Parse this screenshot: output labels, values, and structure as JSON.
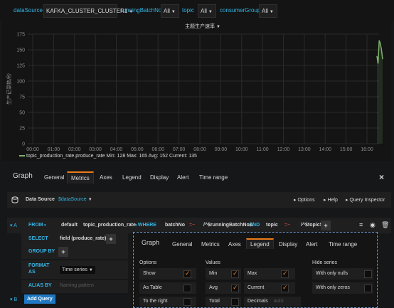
{
  "vars": [
    {
      "label": "dataSource",
      "value": "KAFKA_CLUSTER_CLUSTER1"
    },
    {
      "label": "runningBatchNo",
      "value": "All"
    },
    {
      "label": "topic",
      "value": "All"
    },
    {
      "label": "consumerGroup",
      "value": "All"
    }
  ],
  "chart": {
    "title": "主题生产速率",
    "ylabel": "生产记录数/秒",
    "yticks": [
      "175",
      "150",
      "125",
      "100",
      "75",
      "50",
      "25",
      "0"
    ],
    "xticks": [
      "00:00",
      "01:00",
      "02:00",
      "03:00",
      "04:00",
      "05:00",
      "06:00",
      "07:00",
      "08:00",
      "09:00",
      "10:00",
      "11:00",
      "12:00",
      "13:00",
      "14:00",
      "15:00",
      "16:00"
    ],
    "legend": "topic_production_rate.produce_rate  Min: 128  Max: 165  Avg: 152  Current: 135"
  },
  "chart_data": {
    "type": "line",
    "title": "主题生产速率",
    "ylabel": "生产记录数/秒",
    "xlabel": "",
    "ylim": [
      0,
      175
    ],
    "x": [
      "16:40",
      "16:42",
      "16:44",
      "16:46",
      "16:48",
      "16:50"
    ],
    "series": [
      {
        "name": "topic_production_rate.produce_rate",
        "values": [
          140,
          128,
          165,
          160,
          150,
          135
        ]
      }
    ],
    "grid": true,
    "legend": "bottom-left"
  },
  "editor": {
    "header": "Graph",
    "tabs": [
      "General",
      "Metrics",
      "Axes",
      "Legend",
      "Display",
      "Alert",
      "Time range"
    ],
    "close": "×"
  },
  "datasource": {
    "label": "Data Source",
    "value": "$dataSource",
    "options": "Options",
    "help": "Help",
    "inspector": "Query Inspector"
  },
  "query": {
    "ref": "A",
    "from_kw": "FROM",
    "default": "default",
    "measurement": "topic_production_rate",
    "where_kw": "WHERE",
    "tag1": "batchNo",
    "op1": "=~",
    "val1": "/^$runningBatchNo$/",
    "and": "AND",
    "tag2": "topic",
    "op2": "=~",
    "val2": "/^$topic$/",
    "select_kw": "SELECT",
    "field": "field (produce_rate)",
    "groupby_kw": "GROUP BY",
    "format_kw": "FORMAT AS",
    "format_val": "Time series",
    "alias_kw": "ALIAS BY",
    "alias_placeholder": "Naming pattern",
    "ref_b": "B",
    "add_query": "Add Query"
  },
  "popup": {
    "header": "Graph",
    "tabs": [
      "General",
      "Metrics",
      "Axes",
      "Legend",
      "Display",
      "Alert",
      "Time range"
    ],
    "options_title": "Options",
    "values_title": "Values",
    "hide_title": "Hide series",
    "options": [
      {
        "label": "Show",
        "checked": true
      },
      {
        "label": "As Table",
        "checked": false
      },
      {
        "label": "To the right",
        "checked": false
      }
    ],
    "values_left": [
      {
        "label": "Min",
        "checked": true
      },
      {
        "label": "Avg",
        "checked": true
      },
      {
        "label": "Total",
        "checked": false
      }
    ],
    "values_right": [
      {
        "label": "Max",
        "checked": true
      },
      {
        "label": "Current",
        "checked": true
      },
      {
        "label": "Decimals",
        "placeholder": "auto"
      }
    ],
    "hide": [
      {
        "label": "With only nulls",
        "checked": false
      },
      {
        "label": "With only zeros",
        "checked": false
      }
    ]
  },
  "colors": {
    "accent": "#eb7b18",
    "series": "#7eb26d",
    "keyword": "#33b5e5",
    "popup_border": "#6b94c8"
  }
}
